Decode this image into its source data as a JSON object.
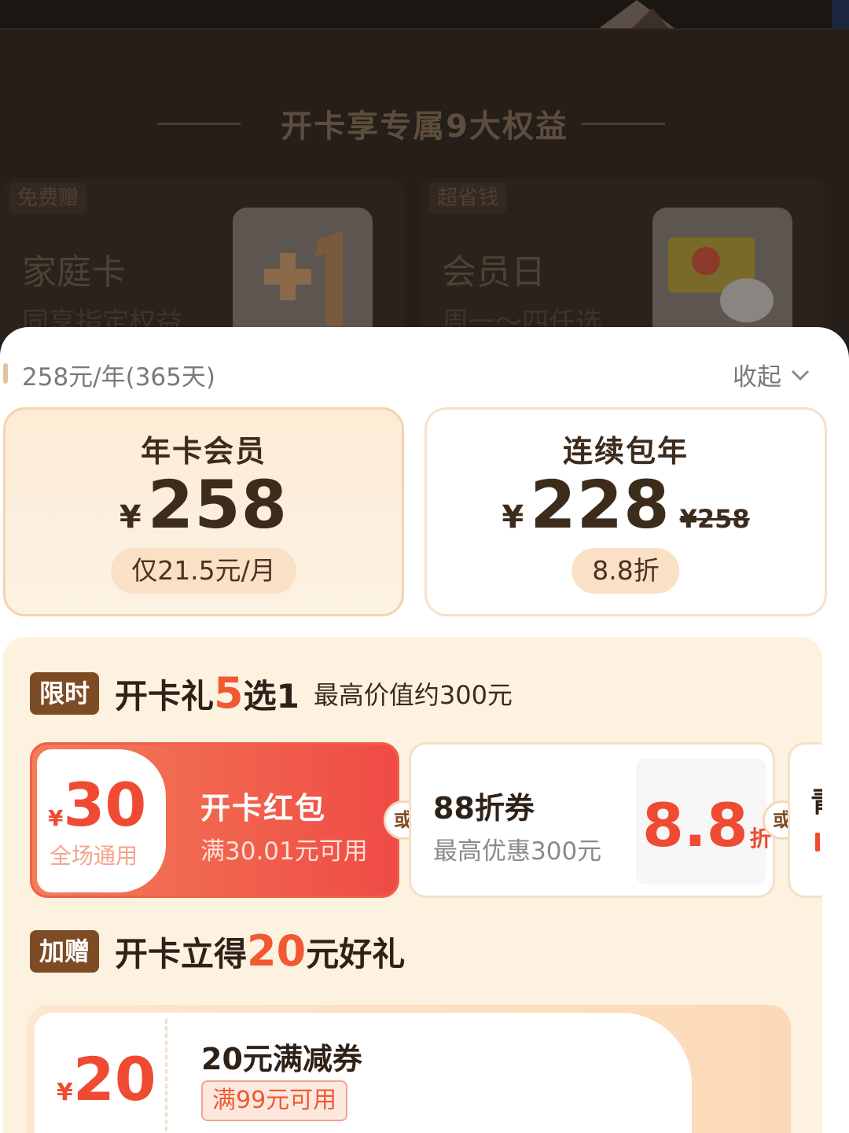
{
  "benefits": {
    "title": "开卡享专属9大权益",
    "cards": [
      {
        "tag": "免费赠",
        "name": "家庭卡",
        "desc": "同享指定权益",
        "icon": "plus-one-icon"
      },
      {
        "tag": "超省钱",
        "name": "会员日",
        "desc": "周一～四任选",
        "icon": "egg-box-icon"
      }
    ]
  },
  "sheet": {
    "price_period": "258元/年(365天)",
    "collapse_label": "收起"
  },
  "plans": [
    {
      "name": "年卡会员",
      "currency": "¥",
      "price": "258",
      "note": "仅21.5元/月",
      "selected": true
    },
    {
      "name": "连续包年",
      "currency": "¥",
      "price": "228",
      "original_price": "¥258",
      "note": "8.8折",
      "selected": false
    }
  ],
  "gift_section": {
    "badge": "限时",
    "title_prefix": "开卡礼",
    "title_highlight": "5",
    "title_suffix": "选1",
    "subtitle": "最高价值约300元",
    "or_label": "或",
    "coupons": [
      {
        "currency": "¥",
        "amount": "30",
        "scope": "全场通用",
        "title": "开卡红包",
        "condition": "满30.01元可用"
      },
      {
        "title": "88折券",
        "condition": "最高优惠300元",
        "discount": "8.8",
        "unit": "折"
      },
      {
        "title_partial": "青"
      }
    ]
  },
  "bonus_section": {
    "badge": "加赠",
    "title_prefix": "开卡立得",
    "title_highlight": "20",
    "title_suffix": "元好礼",
    "coupon": {
      "currency": "¥",
      "amount": "20",
      "title": "20元满减券",
      "condition": "满99元可用"
    }
  },
  "colors": {
    "accent_red": "#ef4b32",
    "brand_brown": "#7d4b24",
    "plan_bg": "#fdebd5"
  }
}
